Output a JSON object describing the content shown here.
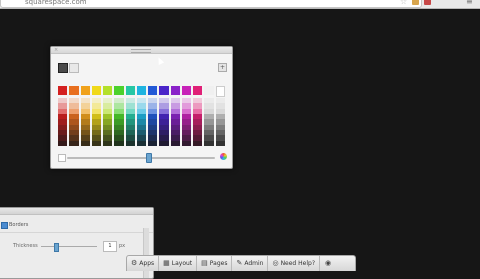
{
  "browser": {
    "url": "squarespace.com"
  },
  "toolbar": {
    "items": [
      {
        "label": "Apps",
        "icon": "apps-icon"
      },
      {
        "label": "Layout",
        "icon": "layout-icon"
      },
      {
        "label": "Pages",
        "icon": "pages-icon"
      },
      {
        "label": "Admin",
        "icon": "wrench-icon"
      },
      {
        "label": "Need Help?",
        "icon": "lifebuoy-icon"
      }
    ],
    "eye_icon": "eye-icon"
  },
  "color_picker": {
    "current_color": "#4a4a4a",
    "previous_color": "#e8e8e8",
    "hue_slider_fraction": 0.55,
    "top_row": [
      "#d42020",
      "#e86f1f",
      "#f0a21c",
      "#f0d91a",
      "#b3e02a",
      "#4cd12c",
      "#26c7a5",
      "#1fb4e0",
      "#2259d6",
      "#4a25c9",
      "#8a22c9",
      "#c822b8",
      "#e02077",
      "#f0f0f0",
      "#ffffff"
    ]
  },
  "border_panel": {
    "section": "Borders",
    "thickness_label": "Thickness",
    "thickness_value": "1",
    "thickness_unit": "px"
  }
}
